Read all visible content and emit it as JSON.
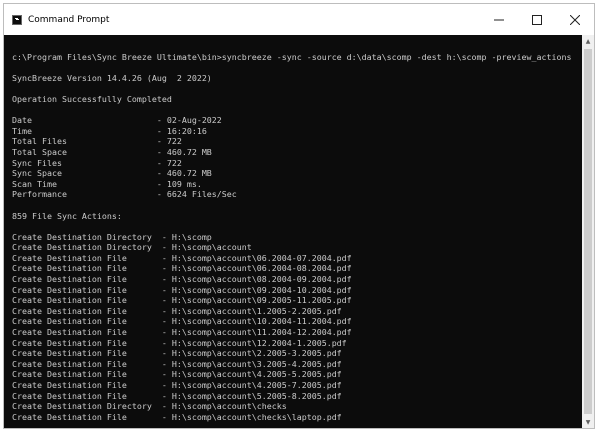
{
  "window": {
    "title": "Command Prompt",
    "controls": {
      "minimize": "minimize",
      "maximize": "maximize",
      "close": "close"
    }
  },
  "console": {
    "lines": [
      "",
      "c:\\Program Files\\Sync Breeze Ultimate\\bin>syncbreeze -sync -source d:\\data\\scomp -dest h:\\scomp -preview_actions",
      "",
      "SyncBreeze Version 14.4.26 (Aug  2 2022)",
      "",
      "Operation Successfully Completed",
      "",
      "Date                         - 02-Aug-2022",
      "Time                         - 16:20:16",
      "Total Files                  - 722",
      "Total Space                  - 460.72 MB",
      "Sync Files                   - 722",
      "Sync Space                   - 460.72 MB",
      "Scan Time                    - 109 ms.",
      "Performance                  - 6624 Files/Sec",
      "",
      "859 File Sync Actions:",
      "",
      "Create Destination Directory  - H:\\scomp",
      "Create Destination Directory  - H:\\scomp\\account",
      "Create Destination File       - H:\\scomp\\account\\06.2004-07.2004.pdf",
      "Create Destination File       - H:\\scomp\\account\\06.2004-08.2004.pdf",
      "Create Destination File       - H:\\scomp\\account\\08.2004-09.2004.pdf",
      "Create Destination File       - H:\\scomp\\account\\09.2004-10.2004.pdf",
      "Create Destination File       - H:\\scomp\\account\\09.2005-11.2005.pdf",
      "Create Destination File       - H:\\scomp\\account\\1.2005-2.2005.pdf",
      "Create Destination File       - H:\\scomp\\account\\10.2004-11.2004.pdf",
      "Create Destination File       - H:\\scomp\\account\\11.2004-12.2004.pdf",
      "Create Destination File       - H:\\scomp\\account\\12.2004-1.2005.pdf",
      "Create Destination File       - H:\\scomp\\account\\2.2005-3.2005.pdf",
      "Create Destination File       - H:\\scomp\\account\\3.2005-4.2005.pdf",
      "Create Destination File       - H:\\scomp\\account\\4.2005-5.2005.pdf",
      "Create Destination File       - H:\\scomp\\account\\4.2005-7.2005.pdf",
      "Create Destination File       - H:\\scomp\\account\\5.2005-8.2005.pdf",
      "Create Destination Directory  - H:\\scomp\\account\\checks",
      "Create Destination File       - H:\\scomp\\account\\checks\\laptop.pdf"
    ]
  },
  "colors": {
    "console_bg": "#0c0c0c",
    "console_text": "#cccccc",
    "titlebar_bg": "#ffffff"
  }
}
